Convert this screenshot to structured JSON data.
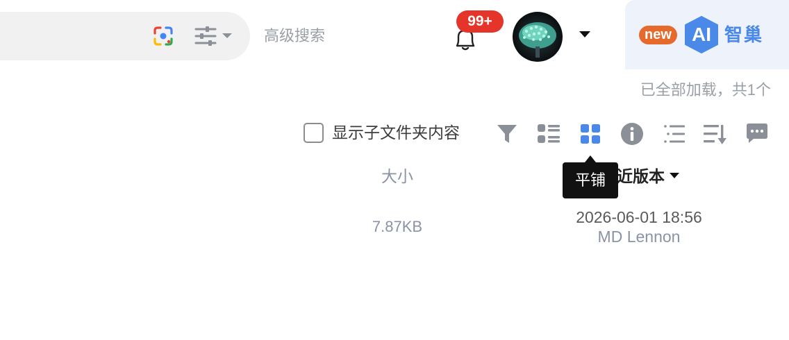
{
  "header": {
    "advanced_search": "高级搜索",
    "notification_count": "99+",
    "ai_badge": "new",
    "ai_logo_text": "AI",
    "ai_name": "智巢"
  },
  "status": {
    "loaded_text": "已全部加载，共1个"
  },
  "toolbar": {
    "show_subfolder_label": "显示子文件夹内容",
    "show_subfolder_checked": false,
    "icons": [
      "filter-icon",
      "list-view-icon",
      "tile-view-icon",
      "info-icon",
      "outline-list-icon",
      "sort-icon",
      "comment-icon"
    ],
    "active_view": "tile"
  },
  "tooltip": {
    "text": "平铺"
  },
  "table": {
    "columns": {
      "size": "大小",
      "version": "近版本"
    },
    "rows": [
      {
        "size": "7.87KB",
        "version_date": "2026-06-01 18:56",
        "version_user": "MD Lennon"
      }
    ]
  },
  "colors": {
    "accent": "#4a89e8",
    "badge": "#e5352a",
    "new_badge": "#e56a2c",
    "ai_panel_bg": "#eef2fb",
    "search_bg": "#f1f1f2"
  }
}
